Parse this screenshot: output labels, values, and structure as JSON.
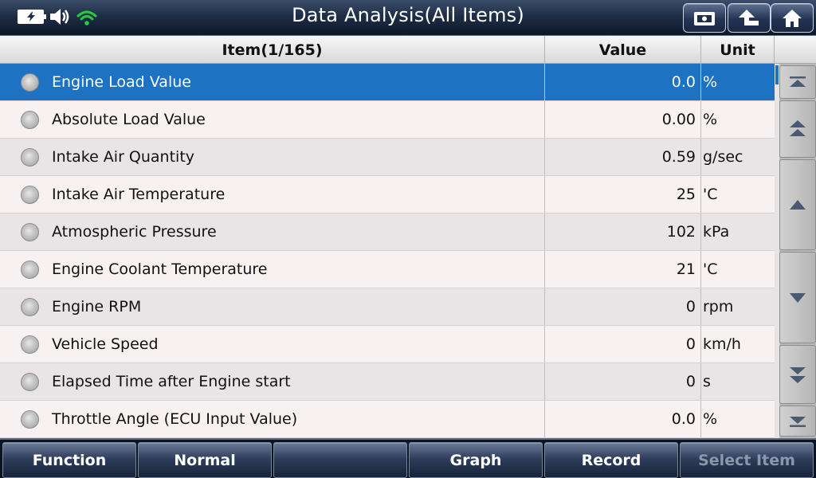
{
  "titlebar": {
    "title": "Data Analysis(All Items)",
    "status_icons": [
      "battery-charging-icon",
      "speaker-icon",
      "wifi-icon"
    ],
    "buttons": [
      "print-icon",
      "back-icon",
      "home-icon"
    ]
  },
  "table": {
    "headers": {
      "item": "Item(1/165)",
      "value": "Value",
      "unit": "Unit"
    },
    "rows": [
      {
        "name": "Engine Load Value",
        "value": "0.0",
        "unit": "%"
      },
      {
        "name": "Absolute Load Value",
        "value": "0.00",
        "unit": "%"
      },
      {
        "name": "Intake Air Quantity",
        "value": "0.59",
        "unit": "g/sec"
      },
      {
        "name": "Intake Air Temperature",
        "value": "25",
        "unit": "'C"
      },
      {
        "name": "Atmospheric Pressure",
        "value": "102",
        "unit": "kPa"
      },
      {
        "name": "Engine Coolant Temperature",
        "value": "21",
        "unit": "'C"
      },
      {
        "name": "Engine RPM",
        "value": "0",
        "unit": "rpm"
      },
      {
        "name": "Vehicle Speed",
        "value": "0",
        "unit": "km/h"
      },
      {
        "name": "Elapsed Time after Engine start",
        "value": "0",
        "unit": "s"
      },
      {
        "name": "Throttle Angle (ECU Input Value)",
        "value": "0.0",
        "unit": "%"
      }
    ],
    "selected_row": 0
  },
  "scroll_buttons": [
    "scroll-top-icon",
    "page-up-icon",
    "line-up-icon",
    "line-down-icon",
    "page-down-icon",
    "scroll-bottom-icon"
  ],
  "bottombar": {
    "function": "Function",
    "normal": "Normal",
    "empty": "",
    "graph": "Graph",
    "record": "Record",
    "select_item": "Select Item"
  },
  "colors": {
    "selected_row": "#1d72c4",
    "wifi": "#27c93f",
    "title_bar": "#1f2e47"
  }
}
